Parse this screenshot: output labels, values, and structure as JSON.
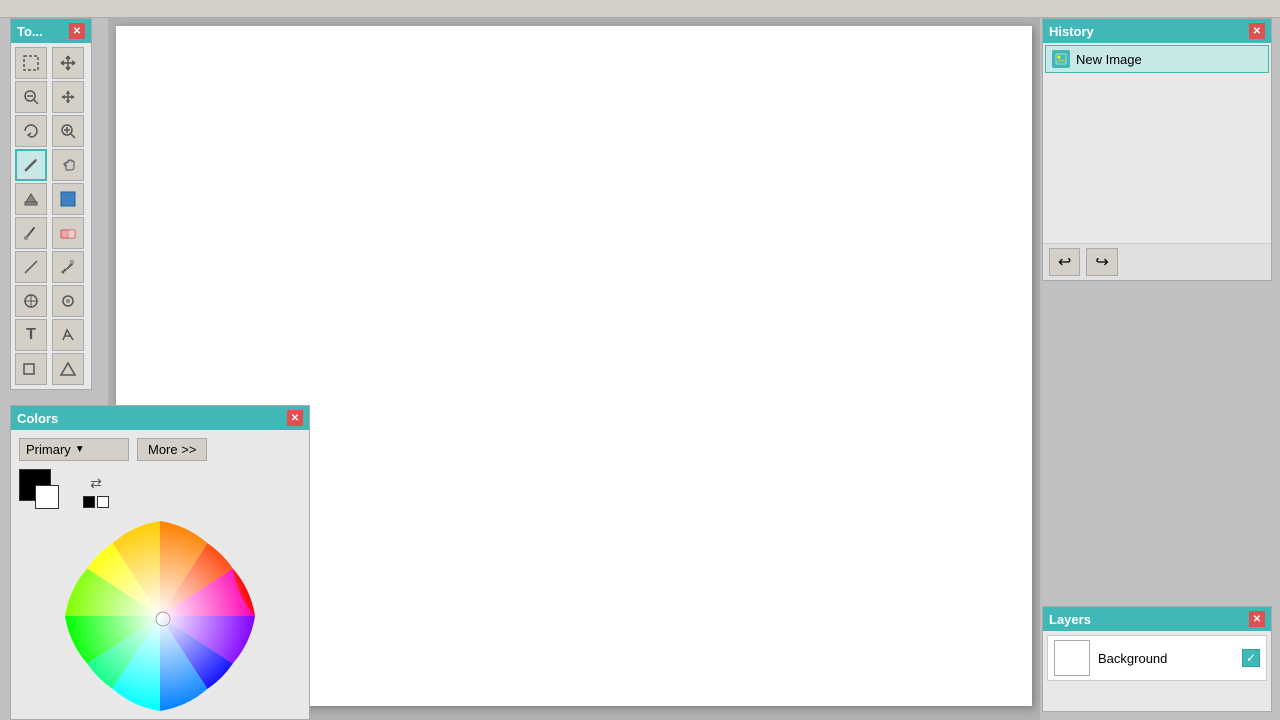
{
  "toolbar": {
    "title": "To...",
    "tools": [
      {
        "id": "select",
        "icon": "⬚",
        "label": "Select"
      },
      {
        "id": "move",
        "icon": "✛",
        "label": "Move"
      },
      {
        "id": "zoom-out",
        "icon": "🔍",
        "label": "Zoom Out"
      },
      {
        "id": "move-cursor",
        "icon": "✛",
        "label": "Move"
      },
      {
        "id": "rotate",
        "icon": "⟳",
        "label": "Rotate"
      },
      {
        "id": "zoom-in",
        "icon": "🔎",
        "label": "Zoom In"
      },
      {
        "id": "pencil",
        "icon": "✏",
        "label": "Pencil"
      },
      {
        "id": "hand",
        "icon": "✋",
        "label": "Hand"
      },
      {
        "id": "fill",
        "icon": "⬡",
        "label": "Fill"
      },
      {
        "id": "rect-select",
        "icon": "▣",
        "label": "Rect Select"
      },
      {
        "id": "brush",
        "icon": "🖌",
        "label": "Brush"
      },
      {
        "id": "eraser",
        "icon": "◫",
        "label": "Eraser"
      },
      {
        "id": "line",
        "icon": "╲",
        "label": "Line"
      },
      {
        "id": "eyedropper",
        "icon": "💉",
        "label": "Eyedropper"
      },
      {
        "id": "clone",
        "icon": "⊕",
        "label": "Clone"
      },
      {
        "id": "heal",
        "icon": "⊙",
        "label": "Heal"
      },
      {
        "id": "text",
        "icon": "T",
        "label": "Text"
      },
      {
        "id": "path",
        "icon": "\\2",
        "label": "Path"
      },
      {
        "id": "shape1",
        "icon": "⬜",
        "label": "Shape 1"
      },
      {
        "id": "shape2",
        "icon": "△",
        "label": "Shape 2"
      }
    ]
  },
  "history": {
    "title": "History",
    "items": [
      {
        "id": "new-image",
        "label": "New Image",
        "icon": "🖼"
      }
    ],
    "undo_label": "↩",
    "redo_label": "↪"
  },
  "layers": {
    "title": "Layers",
    "items": [
      {
        "id": "background",
        "label": "Background",
        "visible": true
      }
    ]
  },
  "colors": {
    "title": "Colors",
    "primary_label": "Primary",
    "more_label": "More >>",
    "primary_color": "#000000",
    "secondary_color": "#ffffff"
  }
}
